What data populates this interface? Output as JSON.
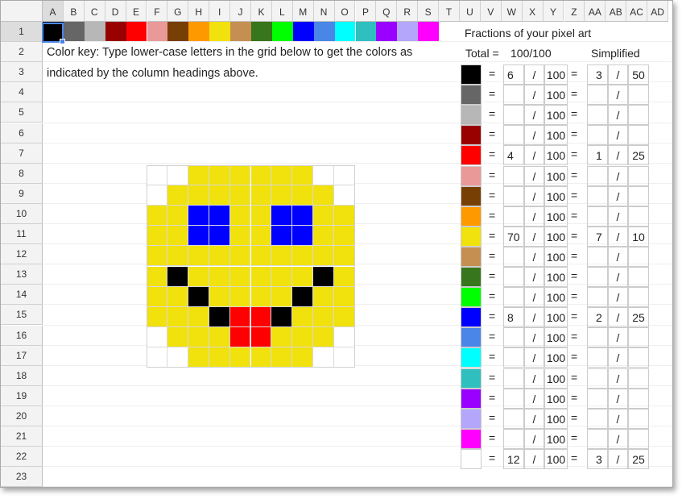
{
  "columns": [
    "A",
    "B",
    "C",
    "D",
    "E",
    "F",
    "G",
    "H",
    "I",
    "J",
    "K",
    "L",
    "M",
    "N",
    "O",
    "P",
    "Q",
    "R",
    "S",
    "T",
    "U",
    "V",
    "W",
    "X",
    "Y",
    "Z",
    "AA",
    "AB",
    "AC",
    "AD"
  ],
  "rows": [
    "1",
    "2",
    "3",
    "4",
    "5",
    "6",
    "7",
    "8",
    "9",
    "10",
    "11",
    "12",
    "13",
    "14",
    "15",
    "16",
    "17",
    "18",
    "19",
    "20",
    "21",
    "22",
    "23"
  ],
  "selected_cell": "A1",
  "color_key_text": [
    "Color key: Type lower-case letters in the grid below to get the colors as",
    "indicated by the column headings above."
  ],
  "palette": [
    "#000000",
    "#666666",
    "#b7b7b7",
    "#990000",
    "#ff0000",
    "#ea9999",
    "#783f04",
    "#ff9900",
    "#f1e10d",
    "#c58f52",
    "#38761d",
    "#00ff00",
    "#0000ff",
    "#4a86e8",
    "#00ffff",
    "#30bfbf",
    "#9900ff",
    "#b4a7fb",
    "#ff00ff"
  ],
  "pixel_art": {
    "palette": {
      ".": "#ffffff",
      "y": "#f1e10d",
      "u": "#0000ff",
      "k": "#000000",
      "r": "#ff0000"
    },
    "rows": [
      "..yyyyyy..",
      ".yyyyyyyy.",
      "yyuuyyuuyy",
      "yyuuyyuuyy",
      "yyyyyyyyyy",
      "ykyyyyyyky",
      "yykyyyykyy",
      "yyykrrkyyy",
      ".yyyrryyy.",
      "..yyyyyy.."
    ]
  },
  "fractions": {
    "title": "Fractions of your pixel art",
    "total_label": "Total =",
    "total_value": "100/100",
    "simplified_label": "Simplified",
    "eq": "=",
    "slash": "/",
    "rows": [
      {
        "color": "#000000",
        "num": "6",
        "den": "100",
        "snum": "3",
        "sden": "50"
      },
      {
        "color": "#666666",
        "num": "",
        "den": "100",
        "snum": "",
        "sden": ""
      },
      {
        "color": "#b7b7b7",
        "num": "",
        "den": "100",
        "snum": "",
        "sden": ""
      },
      {
        "color": "#990000",
        "num": "",
        "den": "100",
        "snum": "",
        "sden": ""
      },
      {
        "color": "#ff0000",
        "num": "4",
        "den": "100",
        "snum": "1",
        "sden": "25"
      },
      {
        "color": "#ea9999",
        "num": "",
        "den": "100",
        "snum": "",
        "sden": ""
      },
      {
        "color": "#783f04",
        "num": "",
        "den": "100",
        "snum": "",
        "sden": ""
      },
      {
        "color": "#ff9900",
        "num": "",
        "den": "100",
        "snum": "",
        "sden": ""
      },
      {
        "color": "#f1e10d",
        "num": "70",
        "den": "100",
        "snum": "7",
        "sden": "10"
      },
      {
        "color": "#c58f52",
        "num": "",
        "den": "100",
        "snum": "",
        "sden": ""
      },
      {
        "color": "#38761d",
        "num": "",
        "den": "100",
        "snum": "",
        "sden": ""
      },
      {
        "color": "#00ff00",
        "num": "",
        "den": "100",
        "snum": "",
        "sden": ""
      },
      {
        "color": "#0000ff",
        "num": "8",
        "den": "100",
        "snum": "2",
        "sden": "25"
      },
      {
        "color": "#4a86e8",
        "num": "",
        "den": "100",
        "snum": "",
        "sden": ""
      },
      {
        "color": "#00ffff",
        "num": "",
        "den": "100",
        "snum": "",
        "sden": ""
      },
      {
        "color": "#30bfbf",
        "num": "",
        "den": "100",
        "snum": "",
        "sden": ""
      },
      {
        "color": "#9900ff",
        "num": "",
        "den": "100",
        "snum": "",
        "sden": ""
      },
      {
        "color": "#b4a7fb",
        "num": "",
        "den": "100",
        "snum": "",
        "sden": ""
      },
      {
        "color": "#ff00ff",
        "num": "",
        "den": "100",
        "snum": "",
        "sden": ""
      },
      {
        "color": "#ffffff",
        "num": "12",
        "den": "100",
        "snum": "3",
        "sden": "25"
      }
    ]
  }
}
